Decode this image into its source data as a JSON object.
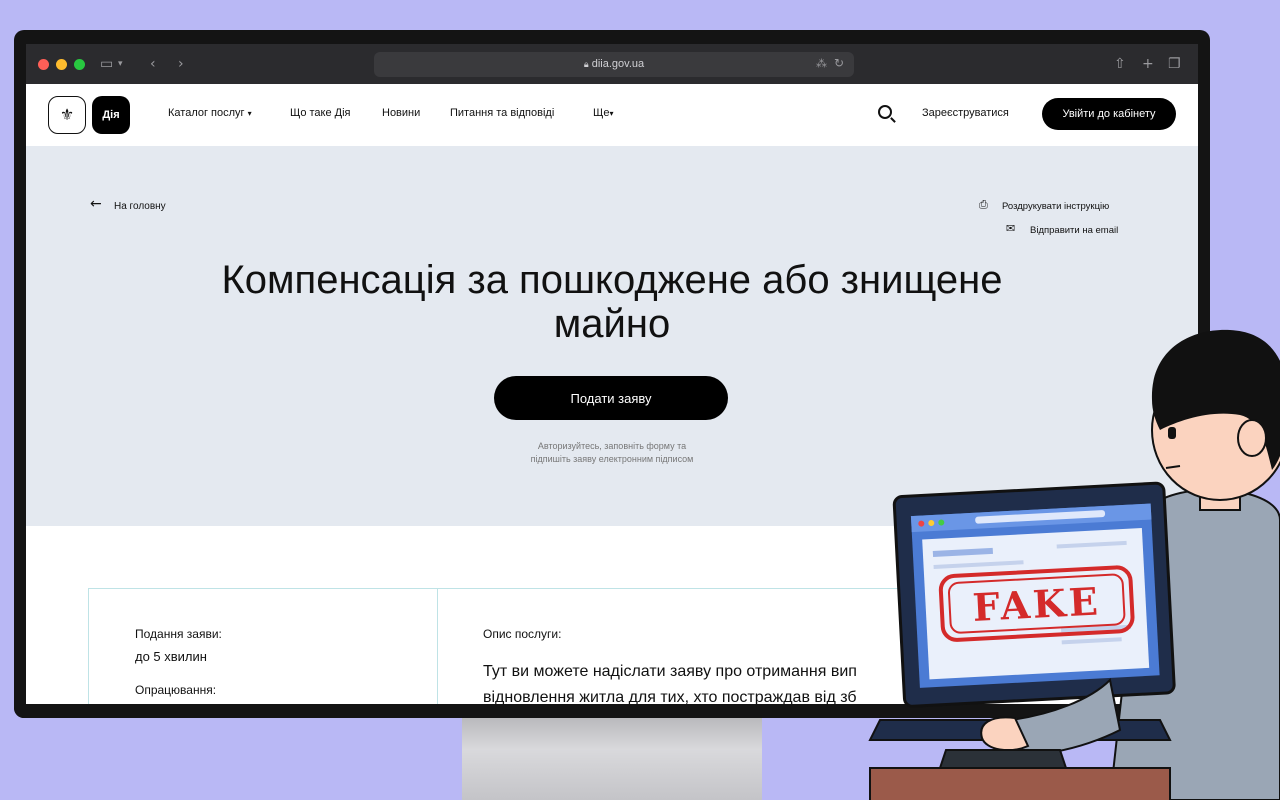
{
  "browser": {
    "url": "diia.gov.ua"
  },
  "nav": {
    "logo_label": "Дія",
    "items": [
      {
        "label": "Каталог послуг"
      },
      {
        "label": "Що таке Дія"
      },
      {
        "label": "Новини"
      },
      {
        "label": "Питання та відповіді"
      },
      {
        "label": "Ще"
      }
    ],
    "register_label": "Зареєструватися",
    "login_label": "Увійти до кабінету"
  },
  "hero": {
    "back_label": "На головну",
    "print_label": "Роздрукувати інструкцію",
    "email_label": "Відправити на email",
    "title_line1": "Компенсація за пошкоджене або знищене",
    "title_line2": "майно",
    "apply_label": "Подати заяву",
    "note_line1": "Авторизуйтесь, заповніть форму та",
    "note_line2": "підпишіть заяву електронним підписом"
  },
  "details": {
    "submit_label": "Подання заяви:",
    "submit_value": "до 5 хвилин",
    "processing_label": "Опрацювання:",
    "desc_label": "Опис послуги:",
    "desc_line1": "Тут ви можете надіслати заяву про отримання вип",
    "desc_line2": "відновлення житла для тих, хто постраждав від зб"
  },
  "illustration": {
    "stamp_text": "FAKE"
  },
  "colors": {
    "background": "#b9b8f5",
    "hero_bg": "#e4e9f0",
    "stamp_red": "#d42a2a",
    "button_black": "#000000"
  }
}
